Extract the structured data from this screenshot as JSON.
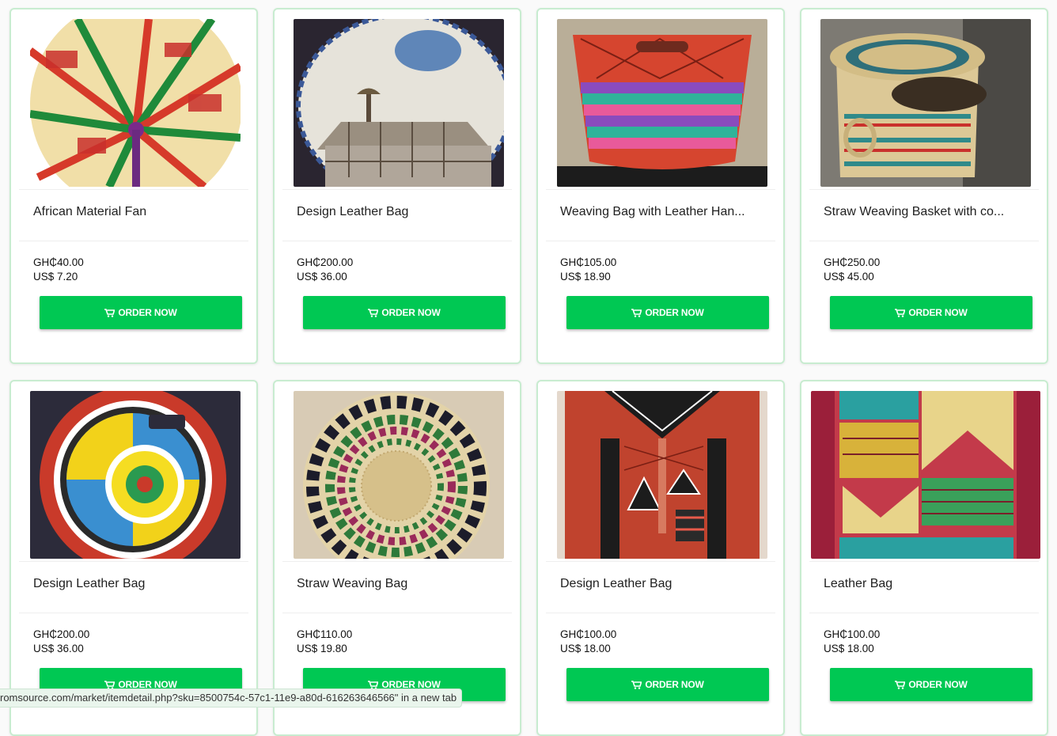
{
  "products": [
    {
      "title": "African Material Fan",
      "price_ghs": "GH₵40.00",
      "price_usd": "US$ 7.20",
      "button": "ORDER NOW",
      "image": "kente-fan-image"
    },
    {
      "title": "Design Leather Bag",
      "price_ghs": "GH₵200.00",
      "price_usd": "US$ 36.00",
      "button": "ORDER NOW",
      "image": "painted-leather-bag-image"
    },
    {
      "title": "Weaving Bag with Leather Han...",
      "price_ghs": "GH₵105.00",
      "price_usd": "US$ 18.90",
      "button": "ORDER NOW",
      "image": "striped-basket-bag-image"
    },
    {
      "title": "Straw Weaving Basket with co...",
      "price_ghs": "GH₵250.00",
      "price_usd": "US$ 45.00",
      "button": "ORDER NOW",
      "image": "lidded-straw-basket-image"
    },
    {
      "title": "Design Leather Bag",
      "price_ghs": "GH₵200.00",
      "price_usd": "US$ 36.00",
      "button": "ORDER NOW",
      "image": "round-woven-bag-image"
    },
    {
      "title": "Straw Weaving Bag",
      "price_ghs": "GH₵110.00",
      "price_usd": "US$ 19.80",
      "button": "ORDER NOW",
      "image": "round-straw-bag-image"
    },
    {
      "title": "Design Leather Bag",
      "price_ghs": "GH₵100.00",
      "price_usd": "US$ 18.00",
      "button": "ORDER NOW",
      "image": "red-leather-bag-image"
    },
    {
      "title": "Leather Bag",
      "price_ghs": "GH₵100.00",
      "price_usd": "US$ 18.00",
      "button": "ORDER NOW",
      "image": "kente-leather-bag-image"
    }
  ],
  "status_bar": {
    "text": "romsource.com/market/itemdetail.php?sku=8500754c-57c1-11e9-a80d-616263646566\" in a new tab"
  },
  "colors": {
    "accent": "#00c853",
    "card_border": "#c8ecd0",
    "page_bg": "#fafafa"
  },
  "icons": {
    "button_icon": "cart-icon"
  }
}
